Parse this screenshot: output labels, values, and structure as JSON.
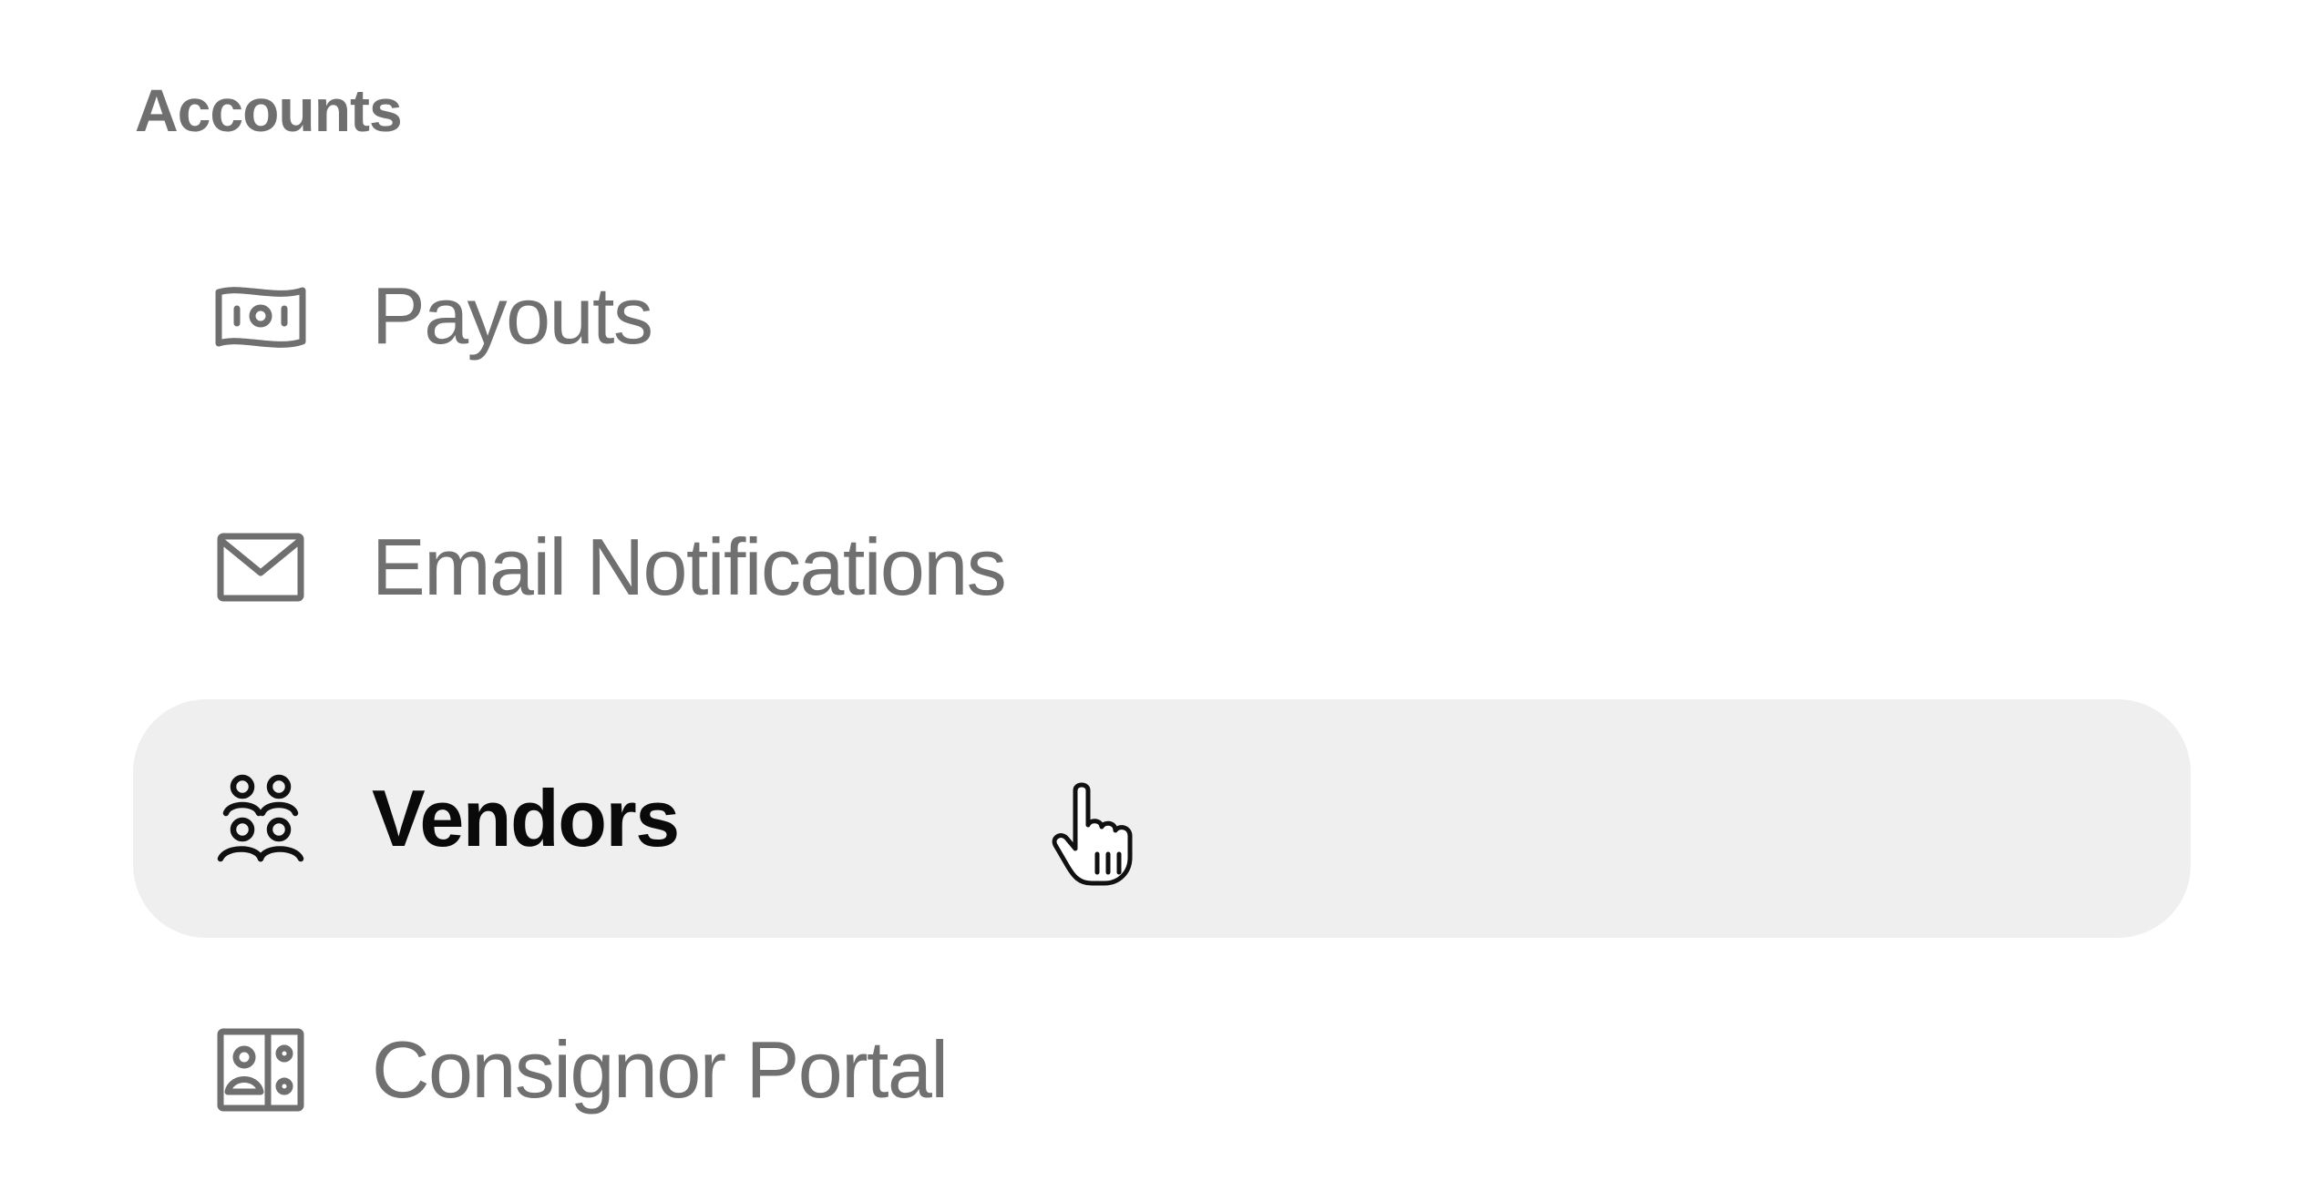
{
  "sidebar": {
    "section_title": "Accounts",
    "items": [
      {
        "label": "Payouts",
        "icon": "banknote-icon",
        "active": false
      },
      {
        "label": "Email Notifications",
        "icon": "envelope-icon",
        "active": false
      },
      {
        "label": "Vendors",
        "icon": "users-group-icon",
        "active": true
      },
      {
        "label": "Consignor Portal",
        "icon": "id-card-icon",
        "active": false
      }
    ]
  },
  "cursor": {
    "icon": "hand-pointer-icon"
  },
  "colors": {
    "text_muted": "#707070",
    "text_active": "#0a0a0a",
    "active_background": "#efefef",
    "section_title": "#6f6f6f"
  }
}
